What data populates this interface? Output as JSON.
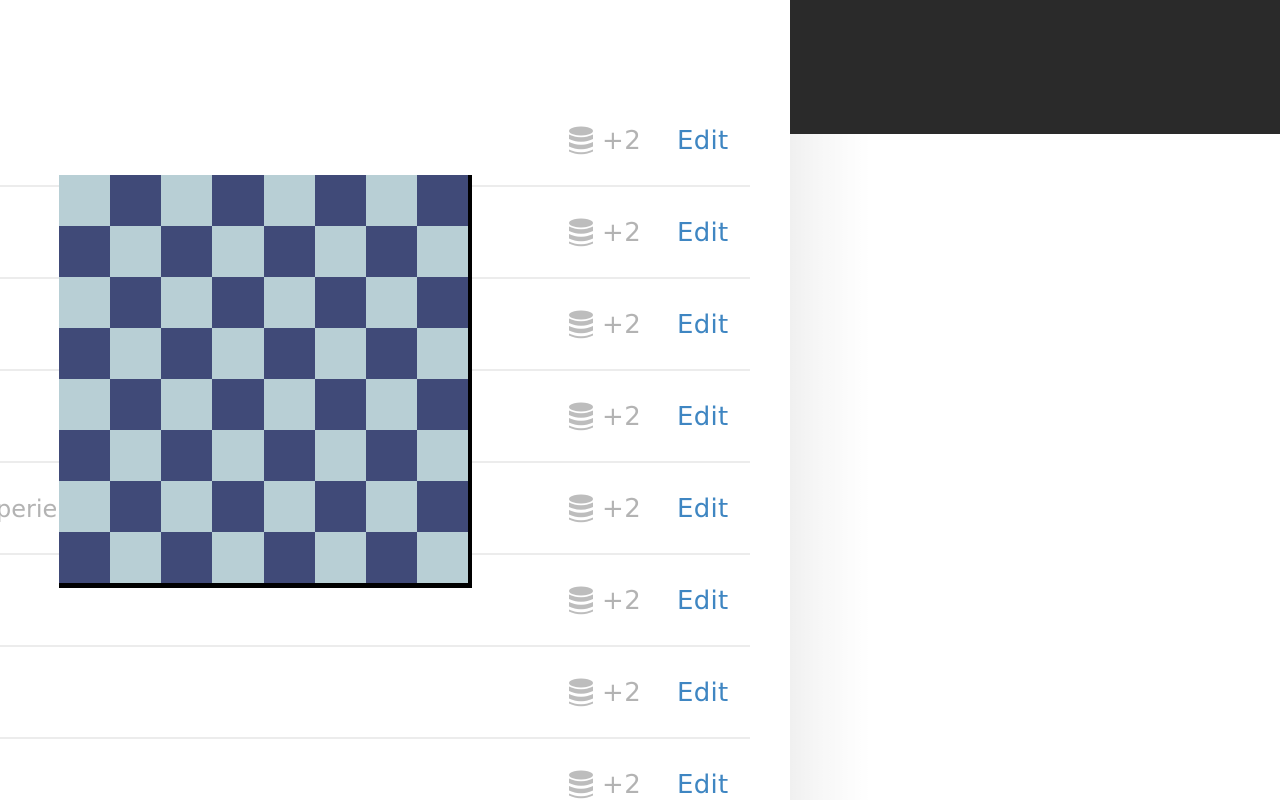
{
  "colors": {
    "accent_link": "#3f86c2",
    "muted_text": "#b3b3b3",
    "board_dark": "#404a78",
    "board_light": "#b8cfd5",
    "header_dark": "#2a2a2a"
  },
  "list": {
    "rows": [
      {
        "icon": "database-icon",
        "count": "+2",
        "edit_label": "Edit",
        "text": ""
      },
      {
        "icon": "database-icon",
        "count": "+2",
        "edit_label": "Edit",
        "text": ""
      },
      {
        "icon": "database-icon",
        "count": "+2",
        "edit_label": "Edit",
        "text": ""
      },
      {
        "icon": "database-icon",
        "count": "+2",
        "edit_label": "Edit",
        "text": ""
      },
      {
        "icon": "database-icon",
        "count": "+2",
        "edit_label": "Edit",
        "text": "perie"
      },
      {
        "icon": "database-icon",
        "count": "+2",
        "edit_label": "Edit",
        "text": ""
      },
      {
        "icon": "database-icon",
        "count": "+2",
        "edit_label": "Edit",
        "text": ""
      },
      {
        "icon": "database-icon",
        "count": "+2",
        "edit_label": "Edit",
        "text": ""
      }
    ]
  },
  "board": {
    "rows": 8,
    "cols": 8,
    "top_left": "light"
  }
}
